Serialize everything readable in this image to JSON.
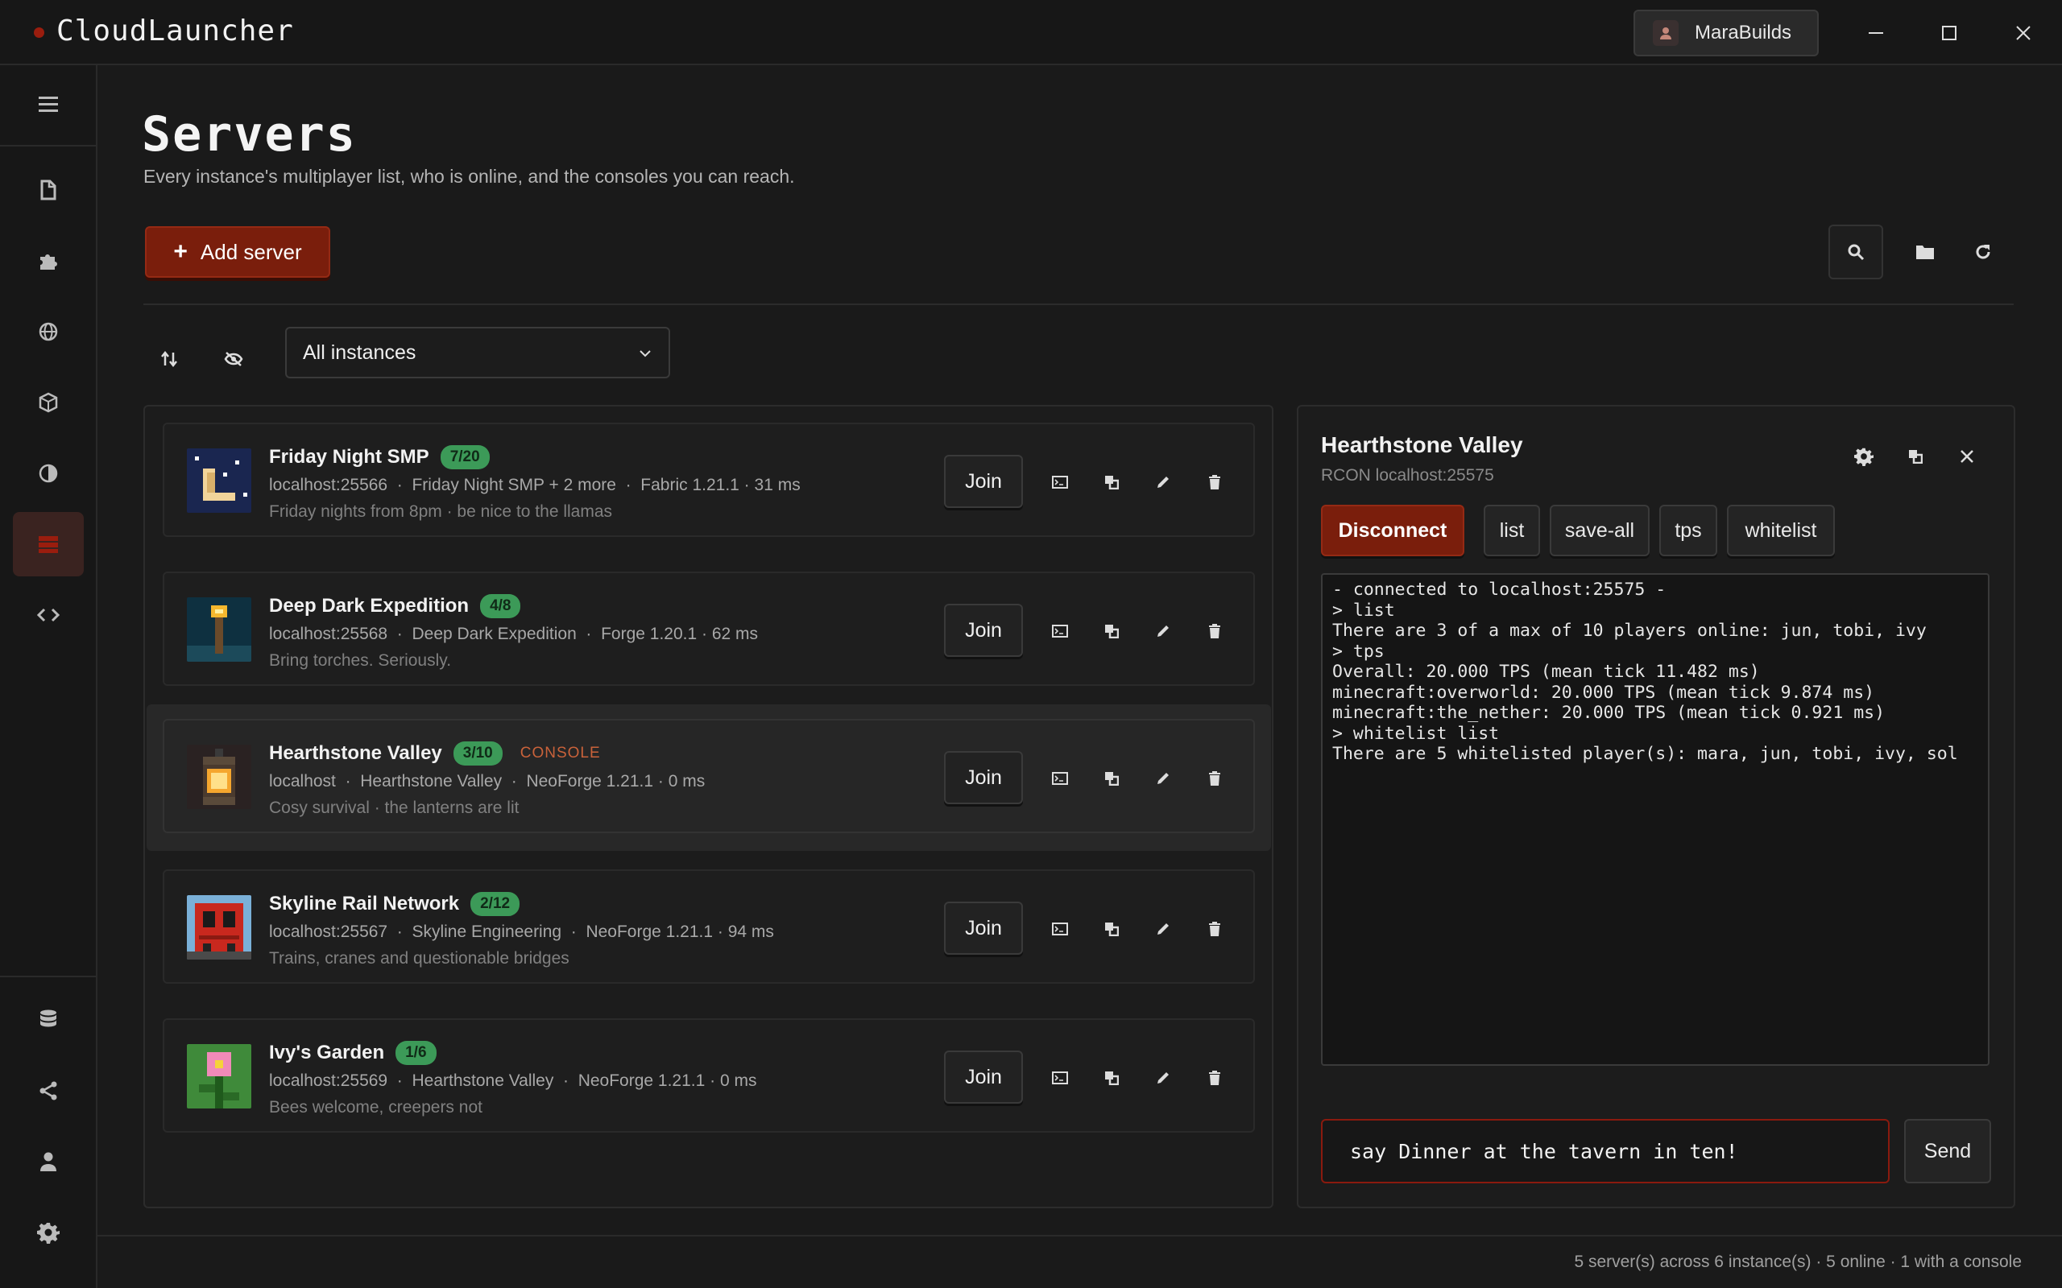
{
  "app": {
    "title": "CloudLauncher",
    "user": "MaraBuilds"
  },
  "nav": {
    "items": [
      "menu-icon",
      "file-icon",
      "puzzle-icon",
      "globe-icon",
      "box-icon",
      "contrast-icon",
      "server-icon",
      "code-icon",
      "database-icon",
      "share-icon",
      "user-icon",
      "gear-icon"
    ],
    "active": "server-icon"
  },
  "page": {
    "title": "Servers",
    "subtitle": "Every instance's multiplayer list, who is online, and the consoles you can reach.",
    "add_server_label": "Add server",
    "instance_filter": "All instances"
  },
  "servers": [
    {
      "name": "Friday Night SMP",
      "players": "7/20",
      "console": "",
      "address": "localhost:25566",
      "instance": "Friday Night SMP + 2 more",
      "info": "Fabric 1.21.1 · 31 ms",
      "motd": "Friday nights from 8pm · be nice to the llamas",
      "join_label": "Join"
    },
    {
      "name": "Deep Dark Expedition",
      "players": "4/8",
      "console": "",
      "address": "localhost:25568",
      "instance": "Deep Dark Expedition",
      "info": "Forge 1.20.1 · 62 ms",
      "motd": "Bring torches. Seriously.",
      "join_label": "Join"
    },
    {
      "name": "Hearthstone Valley",
      "players": "3/10",
      "console": "CONSOLE",
      "address": "localhost",
      "instance": "Hearthstone Valley",
      "info": "NeoForge 1.21.1 · 0 ms",
      "motd": "Cosy survival · the lanterns are lit",
      "join_label": "Join"
    },
    {
      "name": "Skyline Rail Network",
      "players": "2/12",
      "console": "",
      "address": "localhost:25567",
      "instance": "Skyline Engineering",
      "info": "NeoForge 1.21.1 · 94 ms",
      "motd": "Trains, cranes and questionable bridges",
      "join_label": "Join"
    },
    {
      "name": "Ivy's Garden",
      "players": "1/6",
      "console": "",
      "address": "localhost:25569",
      "instance": "Hearthstone Valley",
      "info": "NeoForge 1.21.1 · 0 ms",
      "motd": "Bees welcome, creepers not",
      "join_label": "Join"
    }
  ],
  "selected_index": 2,
  "console": {
    "title": "Hearthstone Valley",
    "subtitle": "RCON localhost:25575",
    "disconnect_label": "Disconnect",
    "quick_commands": [
      "list",
      "save-all",
      "tps",
      "whitelist"
    ],
    "output": "- connected to localhost:25575 -\n> list\nThere are 3 of a max of 10 players online: jun, tobi, ivy\n> tps\nOverall: 20.000 TPS (mean tick 11.482 ms)\nminecraft:overworld: 20.000 TPS (mean tick 9.874 ms)\nminecraft:the_nether: 20.000 TPS (mean tick 0.921 ms)\n> whitelist list\nThere are 5 whitelisted player(s): mara, jun, tobi, ivy, sol",
    "input_value": "say Dinner at the tavern in ten!",
    "send_label": "Send"
  },
  "status": {
    "text": "5 server(s) across 6 instance(s) · 5 online · 1 with a console"
  },
  "colors": {
    "accent": "#7a1e0c",
    "badge": "#3c9a58",
    "console_tag": "#c9623a"
  }
}
